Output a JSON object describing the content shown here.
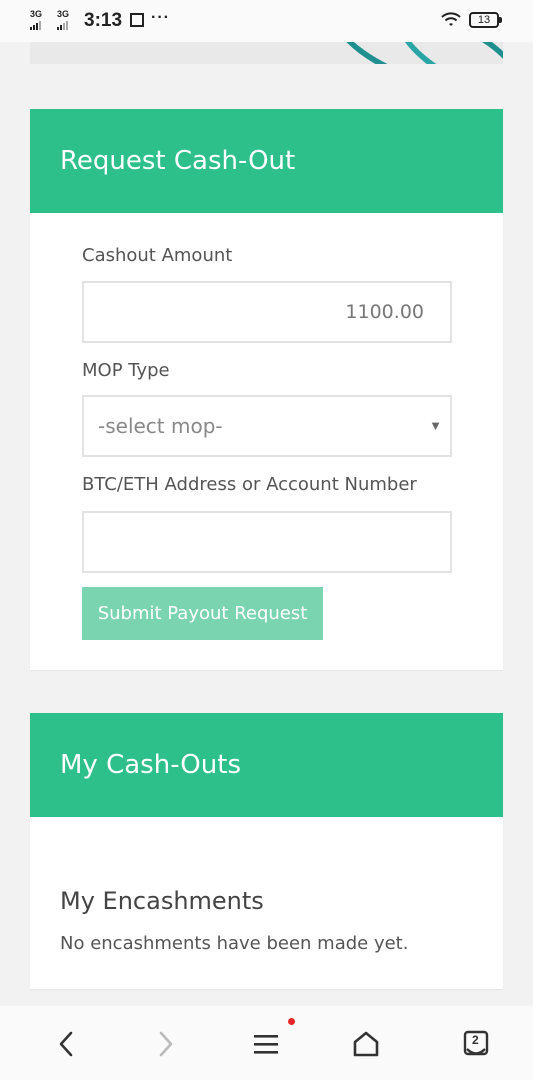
{
  "status_bar": {
    "net1": "3G",
    "net2": "3G",
    "time": "3:13",
    "more": "···",
    "battery": "13"
  },
  "cashout_card": {
    "title": "Request Cash-Out",
    "amount_label": "Cashout Amount",
    "amount_value": "1100.00",
    "mop_label": "MOP Type",
    "mop_selected": "-select mop-",
    "address_label": "BTC/ETH Address or Account Number",
    "address_value": "",
    "submit_label": "Submit Payout Request"
  },
  "my_cashouts_card": {
    "title": "My Cash-Outs",
    "section_title": "My Encashments",
    "empty_text": "No encashments have been made yet."
  },
  "bottom_nav": {
    "tabs_count": "2"
  },
  "colors": {
    "header_green": "#2dc08a",
    "button_green_light": "#7ad4b0",
    "notification_dot": "#e5252a"
  }
}
